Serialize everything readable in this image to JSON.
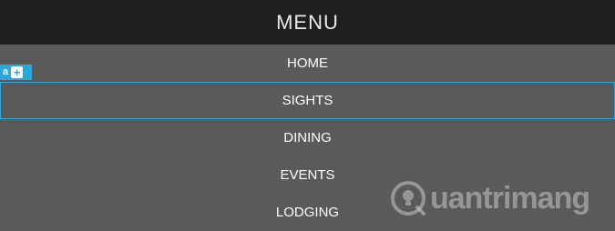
{
  "header": {
    "title": "MENU"
  },
  "menu": {
    "items": [
      {
        "label": "HOME"
      },
      {
        "label": "SIGHTS"
      },
      {
        "label": "DINING"
      },
      {
        "label": "EVENTS"
      },
      {
        "label": "LODGING"
      }
    ],
    "selected_label": "SIGHTS"
  },
  "editor_badge": {
    "tag": "a",
    "add_symbol": "+"
  },
  "watermark": {
    "text": "uantrimang",
    "icon": "lightbulb-q-logo"
  },
  "colors": {
    "header_bg": "#1e1e1e",
    "menu_bg": "#5a5a5a",
    "accent": "#29a8e0",
    "text": "#ffffff"
  }
}
